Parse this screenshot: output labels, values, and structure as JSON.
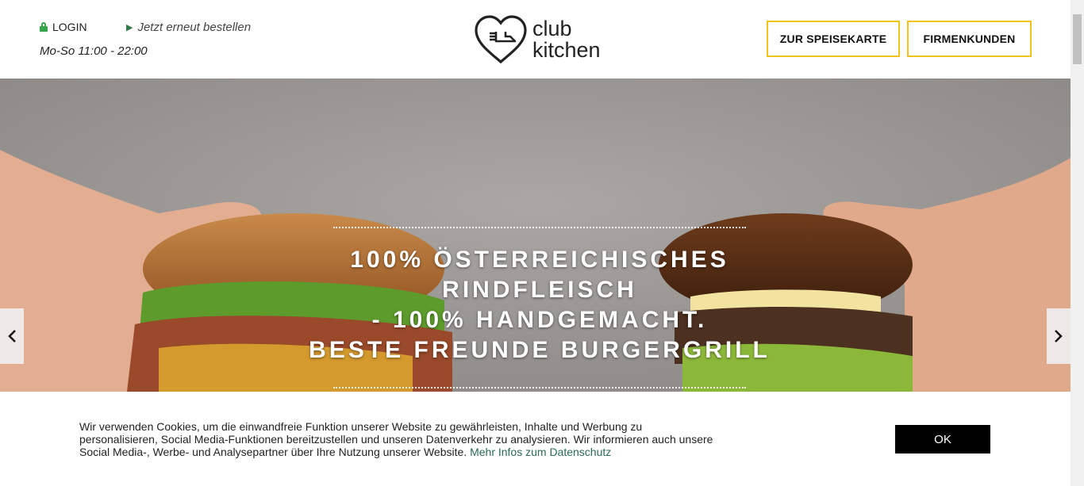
{
  "header": {
    "login_label": "LOGIN",
    "reorder_label": "Jetzt erneut bestellen",
    "hours": "Mo-So 11:00 - 22:00",
    "logo_line1": "club",
    "logo_line2": "kitchen",
    "menu_button": "ZUR SPEISEKARTE",
    "business_button": "FIRMENKUNDEN",
    "accent_color": "#f2c21a"
  },
  "hero": {
    "line1": "100% ÖSTERREICHISCHES",
    "line2": "RINDFLEISCH",
    "line3": "- 100% HANDGEMACHT.",
    "line4": "BESTE FREUNDE BURGERGRILL",
    "prev_icon": "chevron-left-icon",
    "next_icon": "chevron-right-icon"
  },
  "cookie": {
    "text": "Wir verwenden Cookies, um die einwandfreie Funktion unserer Website zu gewährleisten, Inhalte und Werbung zu personalisieren, Social Media-Funktionen bereitzustellen und unseren Datenverkehr zu analysieren. Wir informieren auch unsere Social Media-, Werbe- und Analysepartner über Ihre Nutzung unserer Website.",
    "link": "Mehr Infos zum Datenschutz",
    "ok_label": "OK"
  }
}
